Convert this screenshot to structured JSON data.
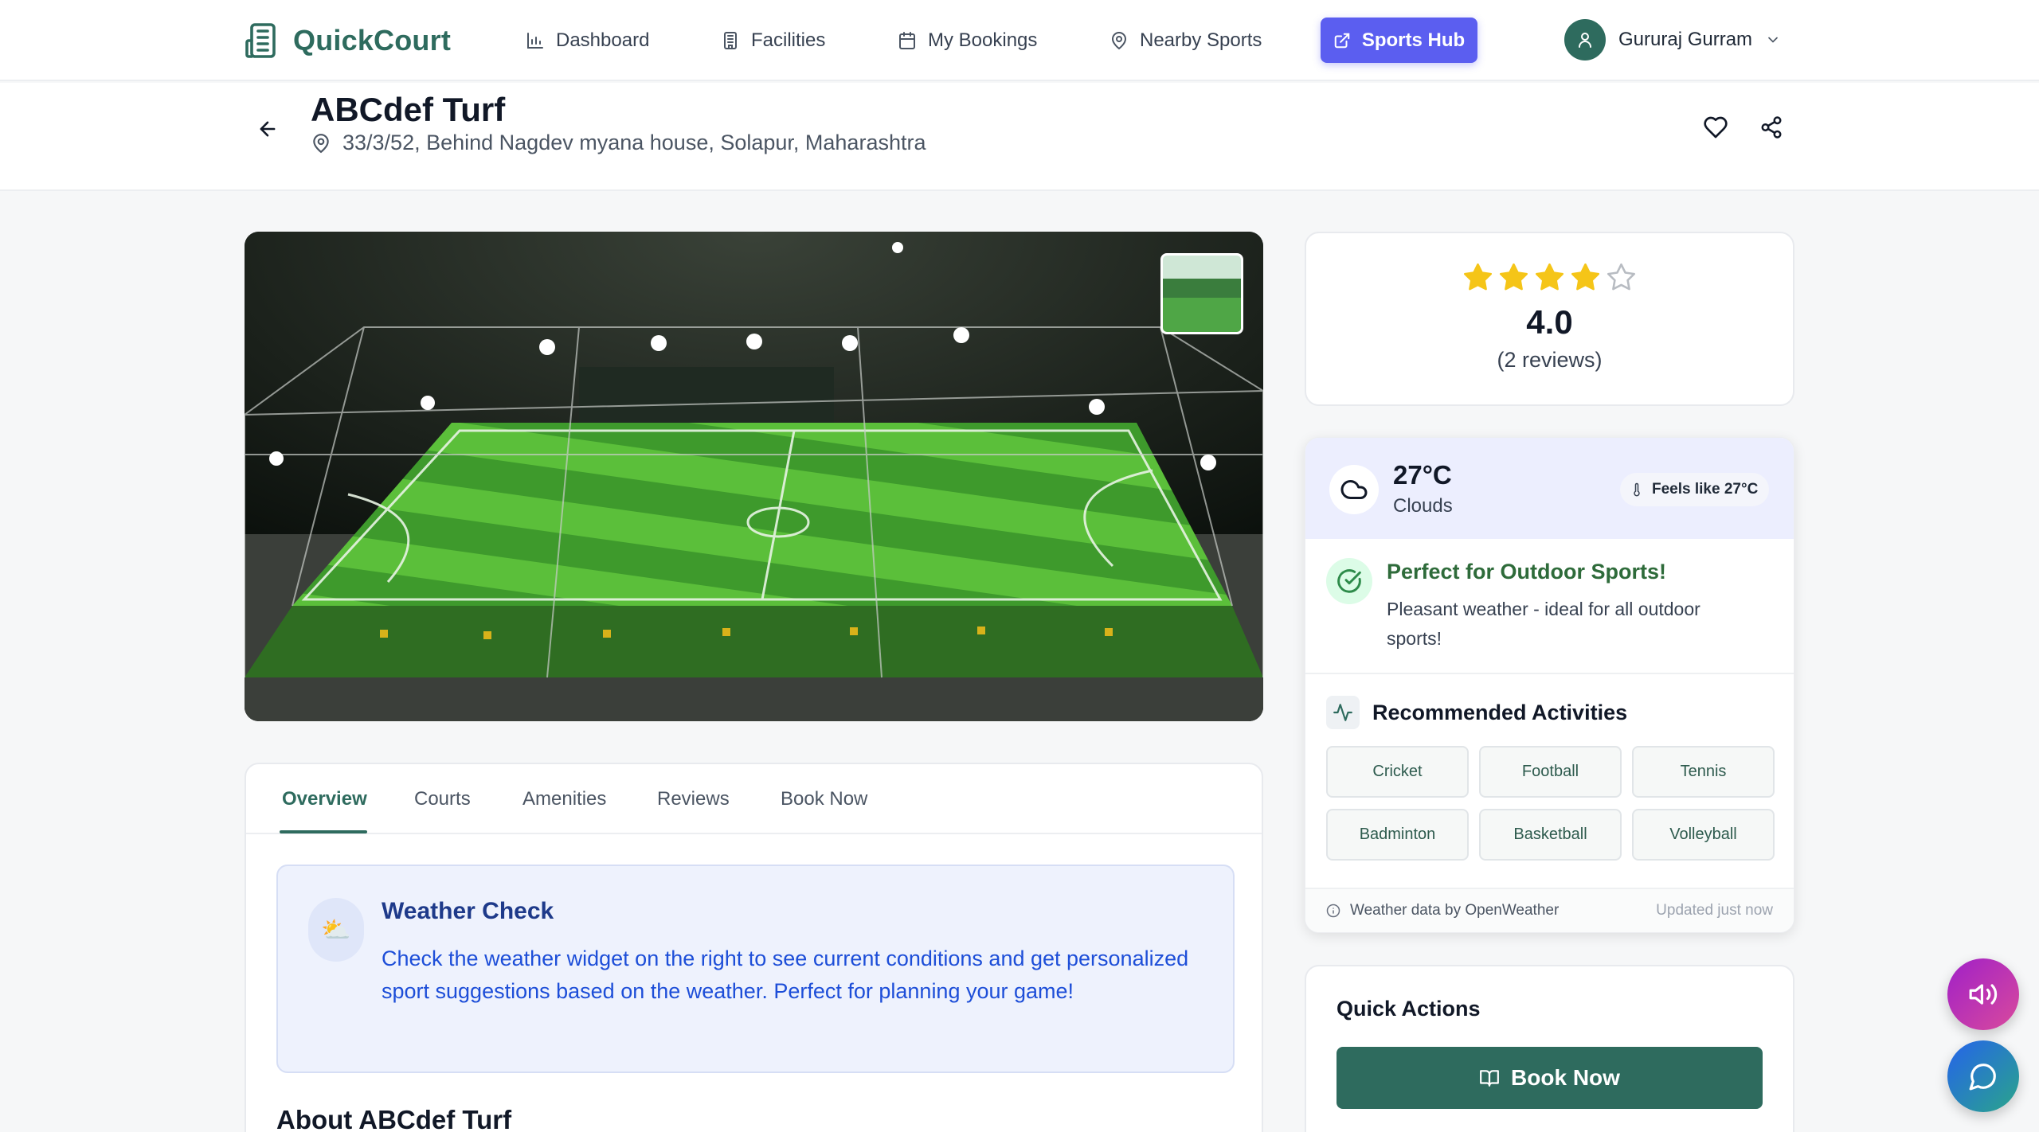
{
  "brand": {
    "name": "QuickCourt"
  },
  "nav": {
    "dashboard": "Dashboard",
    "facilities": "Facilities",
    "my_bookings": "My Bookings",
    "nearby_sports": "Nearby Sports",
    "sports_hub": "Sports Hub"
  },
  "user": {
    "name": "Gururaj Gurram"
  },
  "venue": {
    "title": "ABCdef Turf",
    "address": "33/3/52, Behind Nagdev myana house, Solapur, Maharashtra"
  },
  "tabs": [
    "Overview",
    "Courts",
    "Amenities",
    "Reviews",
    "Book Now"
  ],
  "weather_check": {
    "icon": "⛅",
    "title": "Weather Check",
    "text": "Check the weather widget on the right to see current conditions and get personalized sport suggestions based on the weather. Perfect for planning your game!"
  },
  "about": {
    "title": "About ABCdef Turf"
  },
  "rating": {
    "value": "4.0",
    "count": "(2 reviews)",
    "stars_filled": 4,
    "stars_total": 5
  },
  "weather": {
    "temp": "27°C",
    "condition": "Clouds",
    "feels_like": "Feels like 27°C",
    "perfect_title": "Perfect for Outdoor Sports!",
    "perfect_text": "Pleasant weather - ideal for all outdoor sports!",
    "recommended_title": "Recommended Activities",
    "activities": [
      "Cricket",
      "Football",
      "Tennis",
      "Badminton",
      "Basketball",
      "Volleyball"
    ],
    "source": "Weather data by OpenWeather",
    "updated": "Updated just now"
  },
  "quick_actions": {
    "title": "Quick Actions",
    "book_now": "Book Now"
  },
  "colors": {
    "brand_green": "#2e6b5e",
    "sports_hub": "#5b5ef0",
    "star": "#f5c518"
  },
  "icons": {
    "brand": "building-icon",
    "dashboard": "bar-chart-icon",
    "facilities": "building-icon",
    "bookings": "calendar-icon",
    "nearby": "map-pin-icon",
    "sports_hub": "external-link-icon",
    "back": "arrow-left-icon",
    "favorite": "heart-icon",
    "share": "share-icon",
    "weather": "cloud-icon",
    "feels": "thermometer-icon",
    "perfect": "check-circle-icon",
    "activity": "activity-icon",
    "info": "info-icon",
    "book": "book-open-icon",
    "audio": "speaker-icon",
    "chat": "chat-icon"
  }
}
